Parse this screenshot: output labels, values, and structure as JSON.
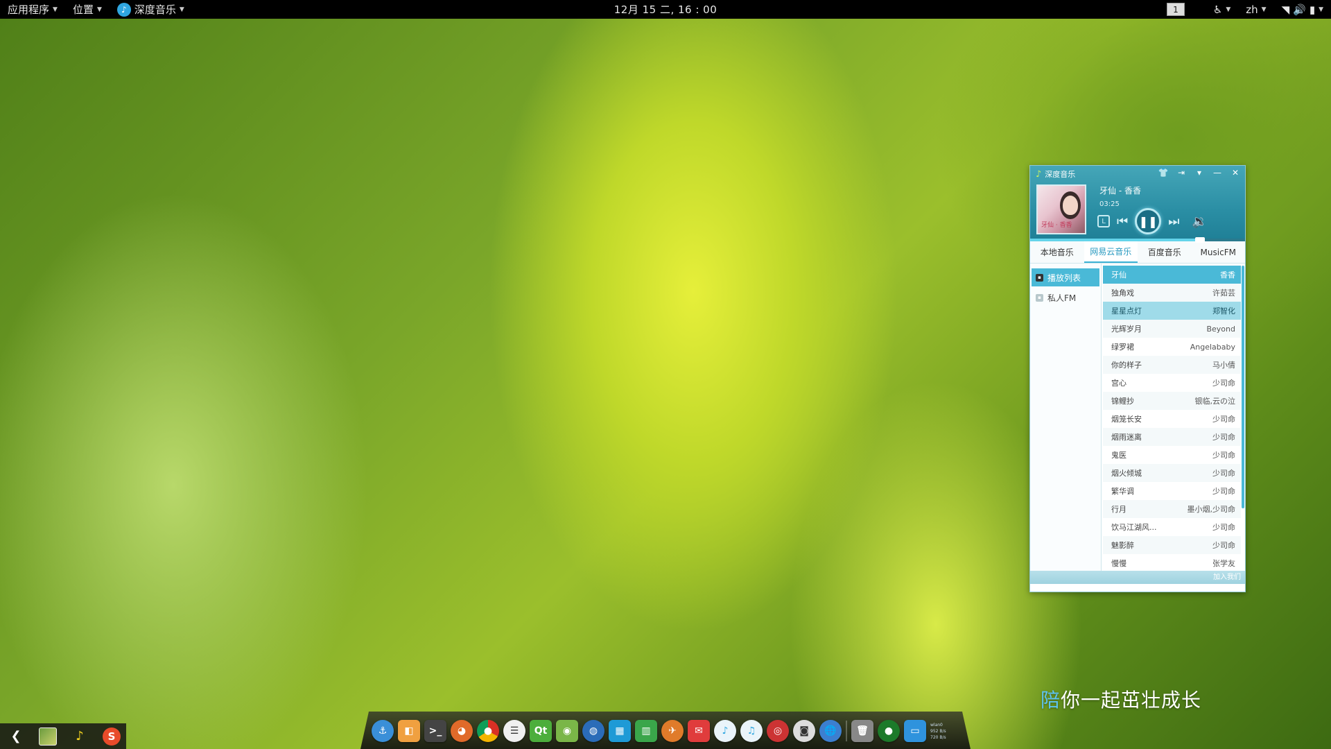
{
  "topbar": {
    "apps_menu": "应用程序",
    "places_menu": "位置",
    "active_app": "深度音乐",
    "clock": "12月 15 二, 16 : 00",
    "workspace": "1",
    "lang": "zh"
  },
  "music": {
    "window_title": "深度音乐",
    "song_title": "牙仙 - 香香",
    "time": "03:25",
    "album_text": "牙仙 · 香香",
    "lyric_btn": "L",
    "progress": 0.79,
    "tabs": [
      "本地音乐",
      "网易云音乐",
      "百度音乐",
      "MusicFM"
    ],
    "active_tab": 1,
    "side": [
      {
        "label": "播放列表",
        "active": true
      },
      {
        "label": "私人FM",
        "active": false
      }
    ],
    "tracks": [
      {
        "title": "牙仙",
        "artist": "香香",
        "state": "playing"
      },
      {
        "title": "独角戏",
        "artist": "许茹芸",
        "state": ""
      },
      {
        "title": "星星点灯",
        "artist": "郑智化",
        "state": "hl"
      },
      {
        "title": "光辉岁月",
        "artist": "Beyond",
        "state": ""
      },
      {
        "title": "绿罗裙",
        "artist": "Angelababy",
        "state": ""
      },
      {
        "title": "你的样子",
        "artist": "马小倩",
        "state": ""
      },
      {
        "title": "宫心",
        "artist": "少司命",
        "state": ""
      },
      {
        "title": "锦鲤抄",
        "artist": "银临,云の泣",
        "state": ""
      },
      {
        "title": "烟笼长安",
        "artist": "少司命",
        "state": ""
      },
      {
        "title": "烟雨迷离",
        "artist": "少司命",
        "state": ""
      },
      {
        "title": "鬼医",
        "artist": "少司命",
        "state": ""
      },
      {
        "title": "烟火倾城",
        "artist": "少司命",
        "state": ""
      },
      {
        "title": "繁华调",
        "artist": "少司命",
        "state": ""
      },
      {
        "title": "行月",
        "artist": "墨小烟,少司命",
        "state": ""
      },
      {
        "title": "饮马江湖风...",
        "artist": "少司命",
        "state": ""
      },
      {
        "title": "魅影醉",
        "artist": "少司命",
        "state": ""
      },
      {
        "title": "慢慢",
        "artist": "张学友",
        "state": ""
      }
    ],
    "footer": "加入我们"
  },
  "slogan": {
    "first": "陪",
    "rest": "你一起茁壮成长"
  },
  "dock": {
    "net_label": "wlan0",
    "net_down": "952 B/s",
    "net_up": "720 B/s"
  }
}
